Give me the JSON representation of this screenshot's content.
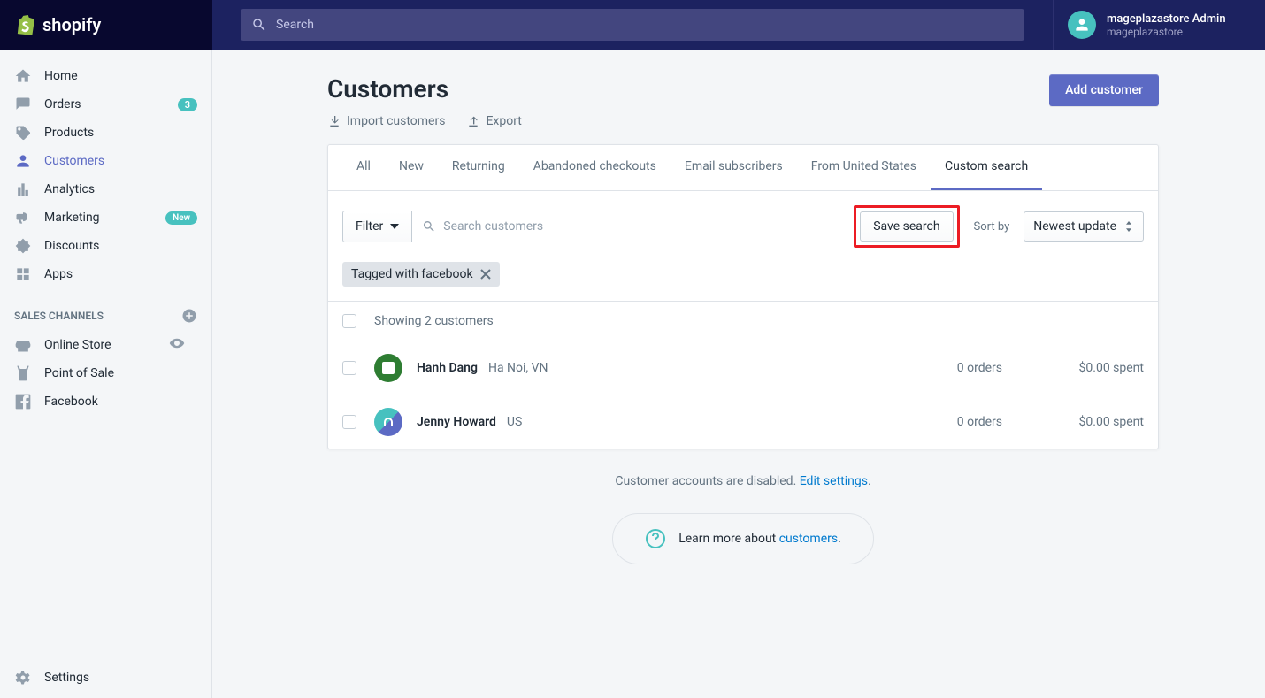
{
  "topbar": {
    "logo_text": "shopify",
    "search_placeholder": "Search",
    "user_name": "mageplazastore Admin",
    "user_sub": "mageplazastore"
  },
  "sidebar": {
    "items": [
      {
        "label": "Home"
      },
      {
        "label": "Orders",
        "badge": "3"
      },
      {
        "label": "Products"
      },
      {
        "label": "Customers",
        "active": true
      },
      {
        "label": "Analytics"
      },
      {
        "label": "Marketing",
        "new_badge": "New"
      },
      {
        "label": "Discounts"
      },
      {
        "label": "Apps"
      }
    ],
    "section_label": "SALES CHANNELS",
    "channels": [
      {
        "label": "Online Store",
        "eye": true
      },
      {
        "label": "Point of Sale"
      },
      {
        "label": "Facebook"
      }
    ],
    "settings_label": "Settings"
  },
  "page": {
    "title": "Customers",
    "import_label": "Import customers",
    "export_label": "Export",
    "add_button": "Add customer"
  },
  "tabs": [
    {
      "label": "All"
    },
    {
      "label": "New"
    },
    {
      "label": "Returning"
    },
    {
      "label": "Abandoned checkouts"
    },
    {
      "label": "Email subscribers"
    },
    {
      "label": "From United States"
    },
    {
      "label": "Custom search",
      "active": true
    }
  ],
  "filter": {
    "filter_label": "Filter",
    "search_placeholder": "Search customers",
    "save_search_label": "Save search",
    "sort_by_label": "Sort by",
    "sort_value": "Newest update"
  },
  "applied_tag": "Tagged with facebook",
  "list": {
    "showing": "Showing 2 customers",
    "rows": [
      {
        "name": "Hanh Dang",
        "location": "Ha Noi, VN",
        "orders": "0 orders",
        "spent": "$0.00 spent",
        "avatar_color1": "#2e7d32",
        "avatar_color2": "#fff"
      },
      {
        "name": "Jenny Howard",
        "location": "US",
        "orders": "0 orders",
        "spent": "$0.00 spent",
        "avatar_color1": "#5c6ac4",
        "avatar_color2": "#47c1bf"
      }
    ]
  },
  "footnote": {
    "text_before": "Customer accounts are disabled. ",
    "link": "Edit settings",
    "text_after": "."
  },
  "learn_more": {
    "text_before": "Learn more about ",
    "link": "customers",
    "text_after": "."
  }
}
